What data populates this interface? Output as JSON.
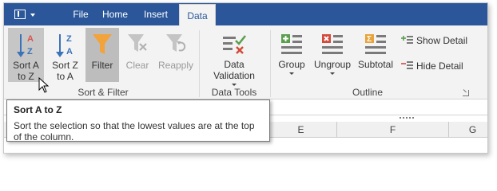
{
  "tabs": [
    "File",
    "Home",
    "Insert",
    "Data"
  ],
  "active_tab": "Data",
  "groups": {
    "sort_filter": {
      "label": "Sort & Filter",
      "sort_az": {
        "line1": "Sort A",
        "line2": "to Z"
      },
      "sort_za": {
        "line1": "Sort Z",
        "line2": "to A"
      },
      "filter": "Filter",
      "clear": "Clear",
      "reapply": "Reapply"
    },
    "data_tools": {
      "label": "Data Tools",
      "data_validation": "Data Validation"
    },
    "outline": {
      "label": "Outline",
      "group": "Group",
      "ungroup": "Ungroup",
      "subtotal": "Subtotal",
      "show_detail": "Show Detail",
      "hide_detail": "Hide Detail"
    }
  },
  "columns": [
    "E",
    "F",
    "G"
  ],
  "tooltip": {
    "title": "Sort A to Z",
    "body": "Sort the selection so that the lowest values are at the top of the column."
  },
  "colors": {
    "tab_bar": "#2b579a",
    "ribbon": "#f3f3f3",
    "accent_blue": "#3b73b9",
    "filter_orange": "#f2a33a",
    "outline_green": "#5a9e4e",
    "outline_red": "#d34a3a",
    "outline_gold": "#e8a33a"
  }
}
